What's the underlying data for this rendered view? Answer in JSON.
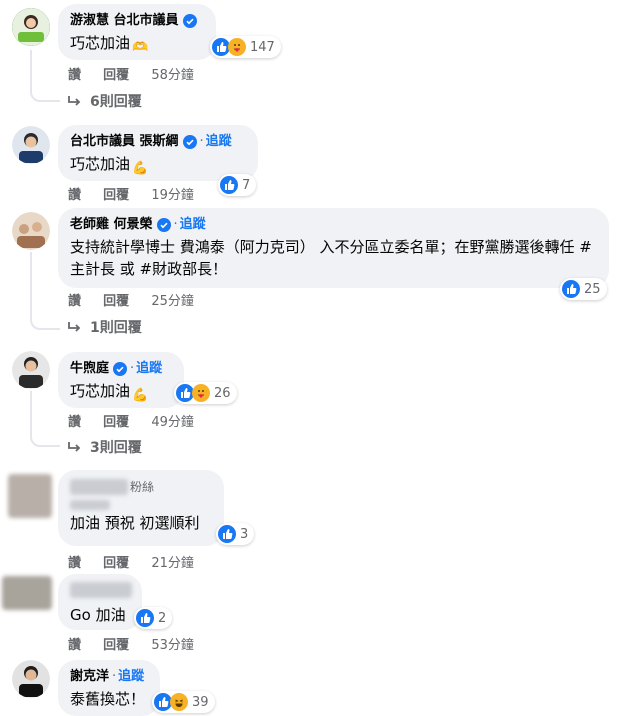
{
  "comments": [
    {
      "name": "游淑慧 台北市議員",
      "text": "巧芯加油",
      "emoji": "🫶",
      "reactions": [
        "like",
        "care"
      ],
      "count": "147",
      "actions": [
        "讚",
        "回覆"
      ],
      "time": "58分鐘",
      "replies": "6則回覆"
    },
    {
      "name": "台北市議員 張斯綱",
      "follow": "追蹤",
      "text": "巧芯加油",
      "emoji": "💪",
      "reactions": [
        "like"
      ],
      "count": "7",
      "actions": [
        "讚",
        "回覆"
      ],
      "time": "19分鐘"
    },
    {
      "name": "老師雞 何景榮",
      "follow": "追蹤",
      "text": "支持統計學博士 費鴻泰（阿力克司） 入不分區立委名單；在野黨勝選後轉任 #主計長 或 #財政部長！",
      "reactions": [
        "like"
      ],
      "count": "25",
      "actions": [
        "讚",
        "回覆"
      ],
      "time": "25分鐘",
      "replies": "1則回覆"
    },
    {
      "name": "牛煦庭",
      "follow": "追蹤",
      "text": "巧芯加油",
      "emoji": "💪",
      "reactions": [
        "like",
        "care"
      ],
      "count": "26",
      "actions": [
        "讚",
        "回覆"
      ],
      "time": "49分鐘",
      "replies": "3則回覆"
    },
    {
      "name_suffix": "粉絲",
      "text": "加油 預祝 初選順利",
      "reactions": [
        "like"
      ],
      "count": "3",
      "actions": [
        "讚",
        "回覆"
      ],
      "time": "21分鐘"
    },
    {
      "text": "Go 加油",
      "reactions": [
        "like"
      ],
      "count": "2",
      "actions": [
        "讚",
        "回覆"
      ],
      "time": "53分鐘"
    },
    {
      "name": "謝克洋",
      "follow": "追蹤",
      "text": "泰舊換芯！",
      "reactions": [
        "like",
        "haha"
      ],
      "count": "39"
    }
  ],
  "colors": {
    "like": "#1877f2",
    "care": "#f7b125",
    "haha": "#f7b125",
    "bubble": "#f0f2f5",
    "link": "#1877f2"
  }
}
